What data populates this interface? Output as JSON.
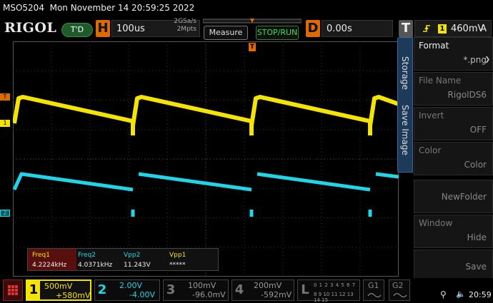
{
  "titlebar": {
    "model": "MSO5204",
    "datetime": "Mon November 14 20:59:25 2022"
  },
  "toolbar": {
    "logo": "RIGOL",
    "trigger_status": "T'D",
    "horizontal": {
      "letter": "H",
      "timebase": "100us",
      "sample_rate": "2GSa/s",
      "memory_depth": "2Mpts"
    },
    "measure_label": "Measure",
    "run_stop_label": "STOP/RUN",
    "delay": {
      "letter": "D",
      "value": "0.00s"
    },
    "trigger": {
      "letter": "T",
      "channel": "1",
      "level": "460mV",
      "mode": "A"
    }
  },
  "side_tabs": {
    "storage": "Storage",
    "save_image": "Save Image"
  },
  "menu": {
    "items": [
      {
        "title": "Format",
        "value": "*.png",
        "enabled": true
      },
      {
        "title": "File Name",
        "value": "RigolDS6",
        "enabled": false
      },
      {
        "title": "Invert",
        "value": "OFF",
        "enabled": false
      },
      {
        "title": "Color",
        "value": "Color",
        "enabled": false
      },
      {
        "title": "",
        "value": "NewFolder",
        "enabled": false
      },
      {
        "title": "Window",
        "value": "Hide",
        "enabled": false
      },
      {
        "title": "",
        "value": "Save",
        "enabled": false
      }
    ]
  },
  "markers": {
    "ch1": "1",
    "ch2": "2",
    "trigger_level": "T",
    "trigger_pos": "T"
  },
  "measurements": {
    "headers": [
      "Freq1",
      "Freq2",
      "Vpp2",
      "Vpp1"
    ],
    "values": [
      "4.2224kHz",
      "4.0371kHz",
      "11.243V",
      "*****"
    ]
  },
  "channels": [
    {
      "num": "1",
      "scale": "500mV",
      "offset": "+580mV",
      "color": "#f5e400",
      "active": true
    },
    {
      "num": "2",
      "scale": "2.00V",
      "offset": "-4.00V",
      "color": "#1fd6e8",
      "active": true
    },
    {
      "num": "3",
      "scale": "100mV",
      "offset": "-96.0mV",
      "color": "#888888",
      "active": false
    },
    {
      "num": "4",
      "scale": "200mV",
      "offset": "-592mV",
      "color": "#888888",
      "active": false
    }
  ],
  "logic": {
    "letter": "L",
    "bits_top": "0 1 2 3 4 5 6 7",
    "bits_bottom": "8 9 10 11 12 13 14 15"
  },
  "generators": {
    "g1": "G1",
    "g2": "G2"
  },
  "status": {
    "clock": "20:59"
  },
  "colors": {
    "ch1": "#f5e400",
    "ch2": "#1fd6e8",
    "accent": "#e06a00",
    "menu_tab": "#1e3a5a"
  }
}
